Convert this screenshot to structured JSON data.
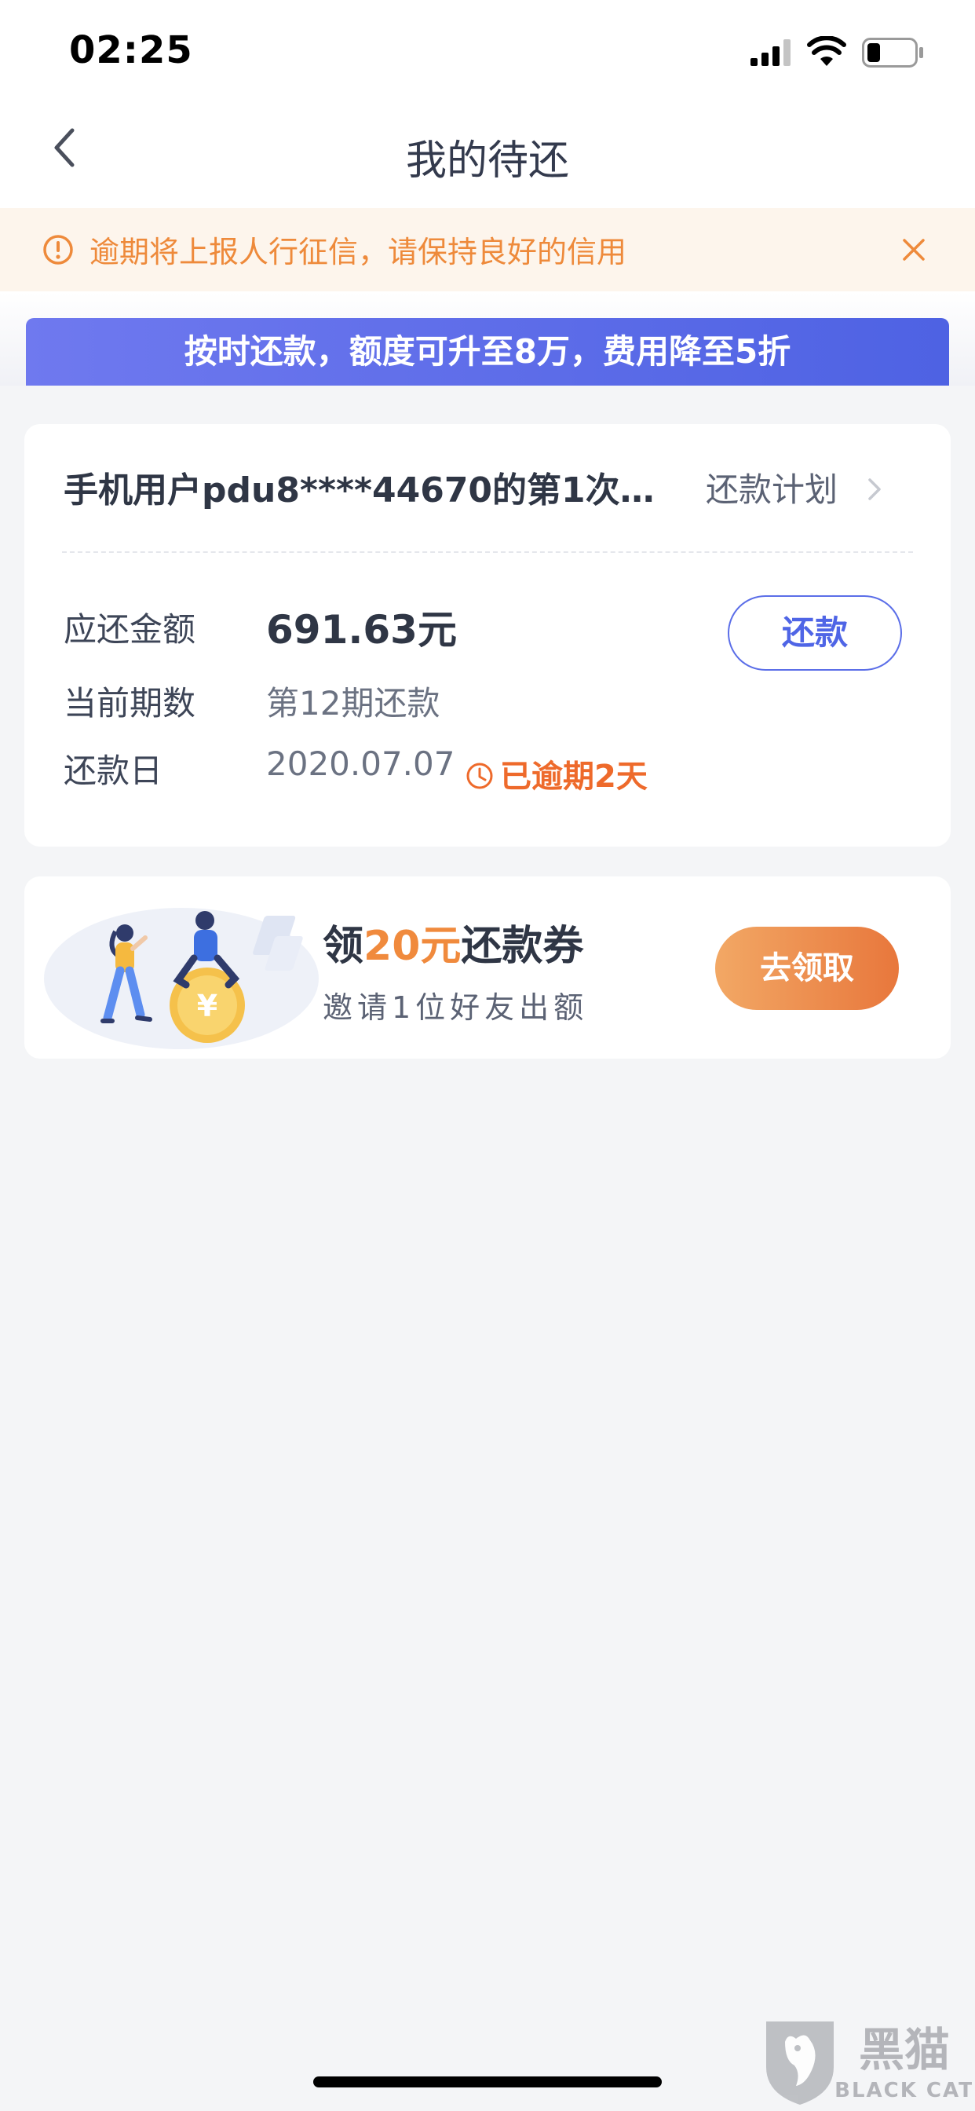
{
  "status_bar": {
    "time": "02:25"
  },
  "header": {
    "title": "我的待还"
  },
  "warning": {
    "text": "逾期将上报人行征信，请保持良好的信用"
  },
  "promo": {
    "text": "按时还款，额度可升至8万，费用降至5折"
  },
  "bill": {
    "title": "手机用户pdu8****44670的第1次…",
    "plan_link": "还款计划",
    "amount_label": "应还金额",
    "amount_value": "691.63元",
    "period_label": "当前期数",
    "period_value": "第12期还款",
    "date_label": "还款日",
    "date_value": "2020.07.07",
    "overdue_text": "已逾期2天",
    "repay_button": "还款"
  },
  "coupon": {
    "title_prefix": "领",
    "title_amount": "20元",
    "title_suffix": "还款券",
    "subtitle": "邀请1位好友出额",
    "button": "去领取"
  },
  "watermark": {
    "text_cn": "黑猫",
    "text_en": "BLACK CAT"
  },
  "colors": {
    "accent": "#4f65e6",
    "warning": "#ee8a3b",
    "overdue": "#ee6a2b",
    "coupon_highlight": "#f08a3d"
  }
}
